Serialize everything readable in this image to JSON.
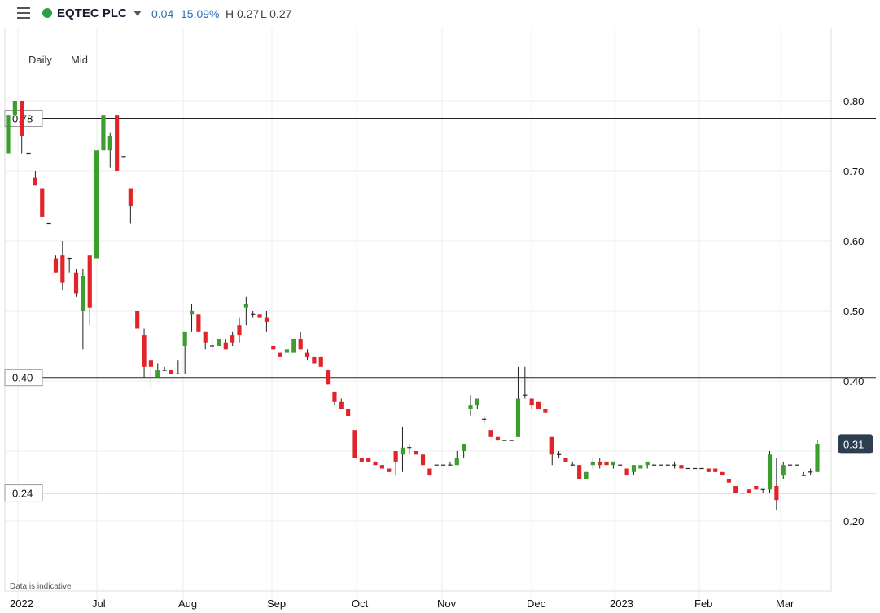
{
  "header": {
    "symbol": "EQTEC PLC",
    "change": "0.04",
    "change_pct": "15.09%",
    "high": "H 0.27",
    "low": "L 0.27",
    "status_color": "#2ea043"
  },
  "chart_controls": {
    "daily": "Daily",
    "mid": "Mid"
  },
  "note": "Data is indicative",
  "colors": {
    "up": "#3b9e2f",
    "down": "#e0242a",
    "accent": "#2c3e50"
  },
  "chart_data": {
    "type": "candlestick",
    "ylim": [
      0.1,
      0.82
    ],
    "yticks": [
      0.2,
      0.3,
      0.4,
      0.5,
      0.6,
      0.7,
      0.8
    ],
    "ytick_labels": [
      "0.20",
      "",
      "0.40",
      "0.50",
      "0.60",
      "0.70",
      "0.80"
    ],
    "xtick_labels": [
      "2022",
      "Jul",
      "Aug",
      "Sep",
      "Oct",
      "Nov",
      "Dec",
      "2023",
      "Feb",
      "Mar"
    ],
    "h_lines": [
      {
        "value": 0.775,
        "label": "0.78"
      },
      {
        "value": 0.405,
        "label": "0.40"
      },
      {
        "value": 0.24,
        "label": "0.24"
      }
    ],
    "last_price": {
      "value": 0.31,
      "label": "0.31"
    },
    "candles": [
      [
        0.725,
        0.78,
        0.725,
        0.78
      ],
      [
        0.78,
        0.8,
        0.775,
        0.8
      ],
      [
        0.8,
        0.8,
        0.725,
        0.75
      ],
      [
        0.725,
        0.725,
        0.725,
        0.725
      ],
      [
        0.69,
        0.7,
        0.68,
        0.68
      ],
      [
        0.675,
        0.675,
        0.635,
        0.635
      ],
      [
        0.625,
        0.625,
        0.625,
        0.625
      ],
      [
        0.575,
        0.58,
        0.555,
        0.555
      ],
      [
        0.58,
        0.6,
        0.53,
        0.54
      ],
      [
        0.575,
        0.575,
        0.555,
        0.575
      ],
      [
        0.555,
        0.56,
        0.52,
        0.525
      ],
      [
        0.5,
        0.56,
        0.445,
        0.55
      ],
      [
        0.58,
        0.58,
        0.48,
        0.505
      ],
      [
        0.575,
        0.65,
        0.575,
        0.73
      ],
      [
        0.73,
        0.78,
        0.73,
        0.78
      ],
      [
        0.73,
        0.755,
        0.705,
        0.75
      ],
      [
        0.78,
        0.78,
        0.7,
        0.7
      ],
      [
        0.72,
        0.72,
        0.72,
        0.72
      ],
      [
        0.675,
        0.675,
        0.625,
        0.65
      ],
      [
        0.5,
        0.5,
        0.475,
        0.475
      ],
      [
        0.465,
        0.475,
        0.405,
        0.42
      ],
      [
        0.43,
        0.435,
        0.39,
        0.42
      ],
      [
        0.405,
        0.425,
        0.405,
        0.415
      ],
      [
        0.415,
        0.42,
        0.415,
        0.415
      ],
      [
        0.415,
        0.415,
        0.41,
        0.41
      ],
      [
        0.41,
        0.43,
        0.41,
        0.41
      ],
      [
        0.45,
        0.46,
        0.41,
        0.47
      ],
      [
        0.495,
        0.51,
        0.47,
        0.5
      ],
      [
        0.495,
        0.495,
        0.47,
        0.47
      ],
      [
        0.47,
        0.47,
        0.445,
        0.455
      ],
      [
        0.45,
        0.46,
        0.44,
        0.45
      ],
      [
        0.45,
        0.455,
        0.45,
        0.46
      ],
      [
        0.455,
        0.46,
        0.445,
        0.445
      ],
      [
        0.465,
        0.47,
        0.45,
        0.455
      ],
      [
        0.48,
        0.49,
        0.455,
        0.465
      ],
      [
        0.505,
        0.52,
        0.48,
        0.51
      ],
      [
        0.495,
        0.5,
        0.49,
        0.495
      ],
      [
        0.495,
        0.495,
        0.49,
        0.49
      ],
      [
        0.49,
        0.5,
        0.47,
        0.485
      ],
      [
        0.45,
        0.45,
        0.445,
        0.445
      ],
      [
        0.44,
        0.44,
        0.435,
        0.435
      ],
      [
        0.44,
        0.45,
        0.44,
        0.445
      ],
      [
        0.44,
        0.455,
        0.445,
        0.46
      ],
      [
        0.46,
        0.47,
        0.445,
        0.445
      ],
      [
        0.44,
        0.445,
        0.43,
        0.435
      ],
      [
        0.435,
        0.435,
        0.425,
        0.425
      ],
      [
        0.435,
        0.435,
        0.42,
        0.42
      ],
      [
        0.415,
        0.415,
        0.395,
        0.395
      ],
      [
        0.385,
        0.385,
        0.365,
        0.37
      ],
      [
        0.37,
        0.375,
        0.36,
        0.36
      ],
      [
        0.36,
        0.36,
        0.35,
        0.35
      ],
      [
        0.33,
        0.33,
        0.29,
        0.29
      ],
      [
        0.29,
        0.29,
        0.285,
        0.285
      ],
      [
        0.29,
        0.29,
        0.285,
        0.285
      ],
      [
        0.285,
        0.285,
        0.28,
        0.28
      ],
      [
        0.28,
        0.28,
        0.275,
        0.275
      ],
      [
        0.275,
        0.275,
        0.27,
        0.27
      ],
      [
        0.3,
        0.3,
        0.265,
        0.285
      ],
      [
        0.295,
        0.335,
        0.27,
        0.305
      ],
      [
        0.305,
        0.31,
        0.295,
        0.305
      ],
      [
        0.3,
        0.3,
        0.295,
        0.295
      ],
      [
        0.295,
        0.295,
        0.28,
        0.28
      ],
      [
        0.275,
        0.275,
        0.265,
        0.265
      ],
      [
        0.28,
        0.28,
        0.28,
        0.28
      ],
      [
        0.28,
        0.28,
        0.28,
        0.28
      ],
      [
        0.28,
        0.285,
        0.28,
        0.28
      ],
      [
        0.28,
        0.3,
        0.28,
        0.29
      ],
      [
        0.3,
        0.3,
        0.29,
        0.31
      ],
      [
        0.36,
        0.38,
        0.35,
        0.365
      ],
      [
        0.365,
        0.375,
        0.36,
        0.375
      ],
      [
        0.345,
        0.35,
        0.34,
        0.345
      ],
      [
        0.33,
        0.33,
        0.32,
        0.32
      ],
      [
        0.32,
        0.32,
        0.315,
        0.315
      ],
      [
        0.315,
        0.315,
        0.315,
        0.315
      ],
      [
        0.315,
        0.315,
        0.315,
        0.315
      ],
      [
        0.32,
        0.42,
        0.32,
        0.375
      ],
      [
        0.38,
        0.42,
        0.375,
        0.38
      ],
      [
        0.375,
        0.375,
        0.36,
        0.365
      ],
      [
        0.37,
        0.37,
        0.36,
        0.36
      ],
      [
        0.36,
        0.36,
        0.355,
        0.355
      ],
      [
        0.32,
        0.32,
        0.28,
        0.295
      ],
      [
        0.295,
        0.3,
        0.29,
        0.295
      ],
      [
        0.29,
        0.29,
        0.285,
        0.285
      ],
      [
        0.28,
        0.285,
        0.28,
        0.28
      ],
      [
        0.28,
        0.28,
        0.26,
        0.26
      ],
      [
        0.26,
        0.27,
        0.26,
        0.27
      ],
      [
        0.28,
        0.29,
        0.275,
        0.285
      ],
      [
        0.285,
        0.29,
        0.275,
        0.28
      ],
      [
        0.285,
        0.285,
        0.28,
        0.28
      ],
      [
        0.28,
        0.285,
        0.275,
        0.285
      ],
      [
        0.28,
        0.28,
        0.28,
        0.28
      ],
      [
        0.275,
        0.275,
        0.265,
        0.265
      ],
      [
        0.27,
        0.28,
        0.265,
        0.28
      ],
      [
        0.275,
        0.275,
        0.275,
        0.28
      ],
      [
        0.28,
        0.285,
        0.275,
        0.285
      ],
      [
        0.28,
        0.28,
        0.28,
        0.28
      ],
      [
        0.28,
        0.28,
        0.28,
        0.28
      ],
      [
        0.28,
        0.28,
        0.28,
        0.28
      ],
      [
        0.28,
        0.285,
        0.275,
        0.28
      ],
      [
        0.28,
        0.28,
        0.275,
        0.275
      ],
      [
        0.275,
        0.275,
        0.275,
        0.275
      ],
      [
        0.275,
        0.275,
        0.275,
        0.275
      ],
      [
        0.275,
        0.275,
        0.275,
        0.275
      ],
      [
        0.275,
        0.275,
        0.27,
        0.27
      ],
      [
        0.275,
        0.275,
        0.27,
        0.27
      ],
      [
        0.27,
        0.27,
        0.265,
        0.265
      ],
      [
        0.26,
        0.26,
        0.255,
        0.255
      ],
      [
        0.25,
        0.25,
        0.24,
        0.24
      ],
      [
        0.24,
        0.24,
        0.24,
        0.24
      ],
      [
        0.245,
        0.245,
        0.24,
        0.24
      ],
      [
        0.25,
        0.25,
        0.245,
        0.245
      ],
      [
        0.245,
        0.245,
        0.24,
        0.245
      ],
      [
        0.245,
        0.3,
        0.24,
        0.295
      ],
      [
        0.25,
        0.29,
        0.215,
        0.23
      ],
      [
        0.265,
        0.285,
        0.26,
        0.28
      ],
      [
        0.28,
        0.28,
        0.28,
        0.28
      ],
      [
        0.28,
        0.28,
        0.28,
        0.28
      ],
      [
        0.265,
        0.27,
        0.265,
        0.265
      ],
      [
        0.27,
        0.275,
        0.265,
        0.27
      ],
      [
        0.27,
        0.315,
        0.27,
        0.31
      ]
    ]
  }
}
